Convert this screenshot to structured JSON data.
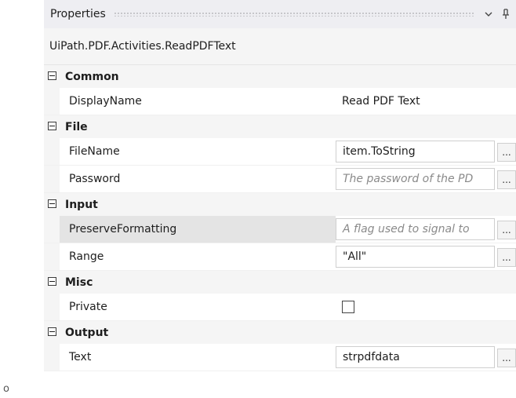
{
  "titlebar": {
    "title": "Properties",
    "dropdown_icon": "chevron-down-icon",
    "pin_icon": "pin-icon"
  },
  "activity_type": "UiPath.PDF.Activities.ReadPDFText",
  "categories": [
    {
      "label": "Common",
      "props": [
        {
          "name": "DisplayName",
          "value": "Read PDF Text",
          "kind": "plain"
        }
      ]
    },
    {
      "label": "File",
      "props": [
        {
          "name": "FileName",
          "value": "item.ToString",
          "kind": "input"
        },
        {
          "name": "Password",
          "value": "The password of the PD",
          "kind": "placeholder"
        }
      ]
    },
    {
      "label": "Input",
      "props": [
        {
          "name": "PreserveFormatting",
          "value": "A flag used to signal to",
          "kind": "placeholder"
        },
        {
          "name": "Range",
          "value": "\"All\"",
          "kind": "input"
        }
      ]
    },
    {
      "label": "Misc",
      "props": [
        {
          "name": "Private",
          "value": "",
          "kind": "checkbox"
        }
      ]
    },
    {
      "label": "Output",
      "props": [
        {
          "name": "Text",
          "value": "strpdfdata",
          "kind": "input"
        }
      ]
    }
  ],
  "ellipsis": "...",
  "stray_glyph": "o"
}
